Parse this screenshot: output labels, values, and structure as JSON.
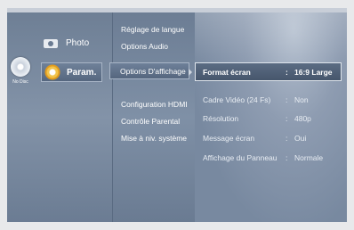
{
  "nodisc": {
    "label": "No Disc"
  },
  "categories": [
    {
      "label": "Photo",
      "icon": "photo-icon"
    },
    {
      "label": "Param.",
      "icon": "gear-icon"
    }
  ],
  "submenu": [
    "Réglage de langue",
    "Options Audio",
    "Options D'affichage",
    "Configuration HDMI",
    "Contrôle Parental",
    "Mise à niv. système"
  ],
  "options": [
    {
      "name": "Format écran",
      "sep": ":",
      "value": "16:9 Large"
    },
    {
      "name": "Cadre Vidéo (24 Fs)",
      "sep": ":",
      "value": "Non"
    },
    {
      "name": "Résolution",
      "sep": ":",
      "value": "480p"
    },
    {
      "name": "Message écran",
      "sep": ":",
      "value": "Oui"
    },
    {
      "name": "Affichage du Panneau",
      "sep": ":",
      "value": "Normale"
    }
  ],
  "colors": {
    "screen_bg": "#73849a",
    "highlight_border": "#dfe5ec",
    "accent": "#e39c1c"
  }
}
